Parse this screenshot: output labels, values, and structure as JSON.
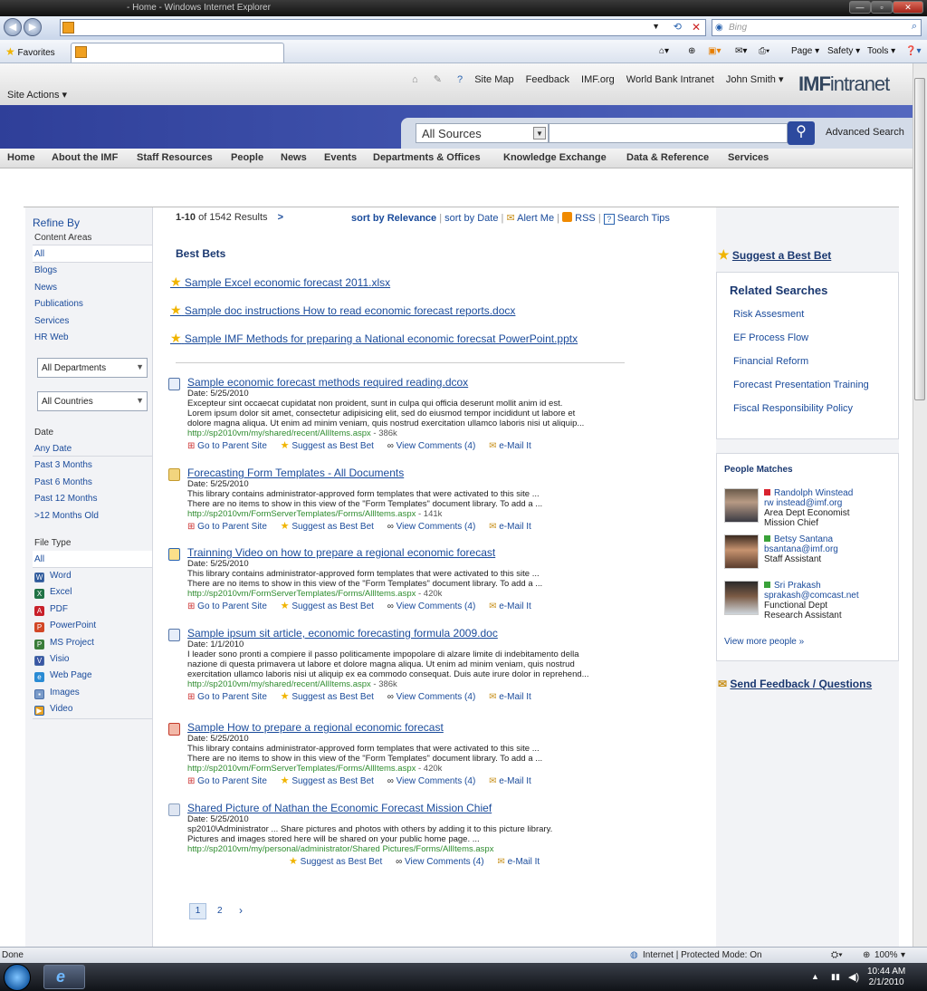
{
  "window": {
    "title": "- Home - Windows Internet Explorer"
  },
  "browser": {
    "search_placeholder": "Bing",
    "favorites": "Favorites",
    "tools": {
      "page": "Page ▾",
      "safety": "Safety ▾",
      "tools": "Tools ▾"
    },
    "status_done": "Done",
    "zone": "Internet | Protected Mode: On",
    "zoom": "100%"
  },
  "taskbar": {
    "time": "10:44 AM",
    "date": "2/1/2010"
  },
  "site": {
    "top_links": [
      "Site Map",
      "Feedback",
      "IMF.org",
      "World Bank Intranet",
      "John Smith ▾"
    ],
    "logo_bold": "IMF",
    "logo_rest": "intranet",
    "site_actions": "Site Actions ▾",
    "search_source": "All Sources",
    "advanced_search": "Advanced Search",
    "nav": [
      "Home",
      "About the IMF",
      "Staff Resources",
      "People",
      "News",
      "Events",
      "Departments & Offices",
      "Knowledge Exchange",
      "Data & Reference",
      "Services"
    ]
  },
  "refine": {
    "title": "Refine By",
    "content_areas": "Content Areas",
    "areas": [
      "All",
      "Blogs",
      "News",
      "Publications",
      "Services",
      "HR Web"
    ],
    "dept": "All Departments",
    "country": "All Countries",
    "date_label": "Date",
    "dates": [
      "Any Date",
      "Past 3 Months",
      "Past 6 Months",
      "Past 12 Months",
      ">12 Months Old"
    ],
    "filetype_label": "File Type",
    "filetypes": [
      "All",
      "Word",
      "Excel",
      "PDF",
      "PowerPoint",
      "MS Project",
      "Visio",
      "Web Page",
      "Images",
      "Video"
    ]
  },
  "results_header": {
    "range": "1-10",
    "of": "of 1542 Results",
    "next": ">",
    "sort_relevance": "sort by Relevance",
    "sort_date": "sort by Date",
    "alert": "Alert Me",
    "rss": "RSS",
    "tips": "Search Tips"
  },
  "best_bets": {
    "title": "Best Bets",
    "items": [
      "Sample Excel economic forecast 2011.xlsx",
      "Sample doc instructions How to read economic forecast reports.docx",
      "Sample IMF Methods for preparing a National economic forecsat PowerPoint.pptx"
    ]
  },
  "results": [
    {
      "title": "Sample economic forecast methods required reading.dcox",
      "date": "Date: 5/25/2010",
      "snippet": [
        "Excepteur sint occaecat cupidatat non proident, sunt in culpa qui officia deserunt mollit anim id est.",
        "Lorem ipsum dolor sit amet, consectetur adipisicing elit, sed do eiusmod tempor incididunt ut labore et",
        "dolore magna aliqua. Ut enim ad minim veniam, quis nostrud exercitation ullamco laboris nisi ut aliquip..."
      ],
      "url": "http://sp2010vm/my/shared/recent/AllItems.aspx",
      "size": " - 386k"
    },
    {
      "title": "Forecasting Form Templates - All Documents",
      "date": "Date: 5/25/2010",
      "snippet": [
        "This library contains administrator-approved form templates that were activated to this site ...",
        "There are no items to show in this view of the \"Form Templates\" document library. To add a ..."
      ],
      "url": "http://sp2010vm/FormServerTemplates/Forms/AllItems.aspx",
      "size": " - 141k"
    },
    {
      "title": "Trainning Video on how to prepare a regional economic forecast",
      "date": "Date: 5/25/2010",
      "snippet": [
        "This library contains administrator-approved form templates that were activated to this site ...",
        "There are no items to show in this view of the \"Form Templates\" document library. To add a ..."
      ],
      "url": "http://sp2010vm/FormServerTemplates/Forms/AllItems.aspx",
      "size": " - 420k"
    },
    {
      "title": "Sample ipsum sit article, economic forecasting formula 2009.doc",
      "date": "Date: 1/1/2010",
      "snippet": [
        "I leader sono pronti a compiere il passo politicamente impopolare di alzare limite di indebitamento della",
        "nazione di questa primavera ut labore et dolore magna aliqua. Ut enim ad minim veniam, quis nostrud",
        "exercitation ullamco laboris nisi ut aliquip ex ea commodo consequat. Duis aute irure dolor in reprehend..."
      ],
      "url": "http://sp2010vm/my/shared/recent/AllItems.aspx",
      "size": " - 386k"
    },
    {
      "title": "Sample How to prepare a regional economic forecast",
      "date": "Date: 5/25/2010",
      "snippet": [
        "This library contains administrator-approved form templates that were activated to this site ...",
        "There are no items to show in this view of the \"Form Templates\" document library. To add a ..."
      ],
      "url": "http://sp2010vm/FormServerTemplates/Forms/AllItems.aspx",
      "size": " - 420k"
    },
    {
      "title": "Shared Picture of Nathan the Economic Forecast Mission Chief",
      "date": "Date: 5/25/2010",
      "snippet": [
        "sp2010\\Administrator ... Share pictures and photos with others by adding it to this picture library.",
        "Pictures and images stored here will be shared on your public home page. ..."
      ],
      "url": "http://sp2010vm/my/personal/administrator/Shared Pictures/Forms/AllItems.aspx",
      "size": ""
    }
  ],
  "result_actions": {
    "parent": "Go to Parent Site",
    "bestbet": "Suggest as Best Bet",
    "comments": "View Comments (4)",
    "mail": "e-Mail It"
  },
  "pagination": {
    "p1": "1",
    "p2": "2",
    "next": "›"
  },
  "right": {
    "suggest": "Suggest a Best Bet",
    "related_title": "Related Searches",
    "related": [
      "Risk Assesment",
      "EF Process Flow",
      "Financial Reform",
      "Forecast Presentation Training",
      "Fiscal Responsibility Policy"
    ],
    "people_title": "People Matches",
    "people": [
      {
        "name": "Randolph Winstead",
        "email": "rw instead@imf.org",
        "l1": "Area Dept Economist",
        "l2": "Mission Chief",
        "status": "#d9232e"
      },
      {
        "name": "Betsy Santana",
        "email": "bsantana@imf.org",
        "l1": "Staff Assistant",
        "l2": "",
        "status": "#3aa23a"
      },
      {
        "name": "Sri Prakash",
        "email": "sprakash@comcast.net",
        "l1": "Functional Dept",
        "l2": "Research Assistant",
        "status": "#3aa23a"
      }
    ],
    "more_people": "View more people »",
    "feedback": "Send Feedback / Questions"
  }
}
